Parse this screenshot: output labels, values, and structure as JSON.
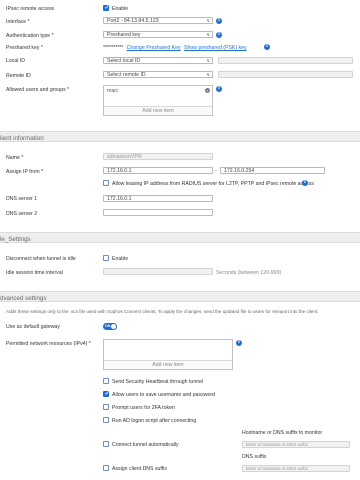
{
  "ipsec": {
    "remote_access_label": "IPsec remote access",
    "enable_label": "Enable",
    "interface_label": "Interface *",
    "interface_value": "Port2 - 84.13.84.5.123",
    "auth_type_label": "Authentication type *",
    "auth_type_value": "Preshared key",
    "preshared_label": "Preshared key *",
    "preshared_mask": "**********",
    "change_psk_link": "Change Preshared Key",
    "show_psk_link": "Show preshared (PSK) key",
    "local_id_label": "Local ID",
    "local_id_placeholder": "Select local ID",
    "remote_id_label": "Remote ID",
    "remote_id_placeholder": "Select remote ID",
    "allowed_label": "Allowed users and groups *",
    "allowed_items": [
      "marc"
    ],
    "add_new_item": "Add new item"
  },
  "client_info": {
    "section_title": "lient information",
    "name_label": "Name *",
    "name_value": "sdmadsonVPN",
    "assign_ip_label": "Assign IP from *",
    "ip_from": "172.16.0.1",
    "ip_dash": "-",
    "ip_to": "172.16.0.254",
    "radius_label": "Allow leasing IP address from RADIUS server for L2TP, PPTP and IPsec remote access",
    "dns1_label": "DNS server 1",
    "dns1_value": "172.16.0.1",
    "dns2_label": "DNS server 2",
    "dns2_value": ""
  },
  "idle": {
    "section_title": "le_Settings",
    "disconnect_label": "Disconnect when tunnel is idle",
    "enable_label": "Enable",
    "idle_time_label": "Idle session time interval",
    "idle_time_value": "",
    "seconds_hint": "Seconds (between 120-999)"
  },
  "advanced": {
    "section_title": "dvanced settings",
    "description": "Adds these settings only to the .scx file used with Sophos Connect clients. To apply the changes, send the updated file to users for reimport into the client.",
    "default_gw_label": "Use as default gateway",
    "toggle_text": "ON",
    "permitted_label": "Permitted network resources (IPv4) *",
    "permitted_items": [],
    "add_new_item": "Add new item",
    "heartbeat_label": "Send Security Heartbeat through tunnel",
    "save_creds_label": "Allow users to save username and password",
    "twofa_label": "Prompt users for 2FA token",
    "ad_logon_label": "Run AD logon script after connecting",
    "auto_connect_label": "Connect tunnel automatically",
    "hostname_label": "Hostname or DNS suffix to monitor",
    "hostname_placeholder": "Enter a hostname or DNS suffix",
    "dns_suffix_label": "DNS suffix",
    "dns_suffix_placeholder": "Enter a hostname or DNS suffix",
    "assign_dns_label": "Assign client DNS suffix"
  },
  "colors": {
    "accent": "#1f6fd0",
    "section_bg": "#eeeeee"
  }
}
